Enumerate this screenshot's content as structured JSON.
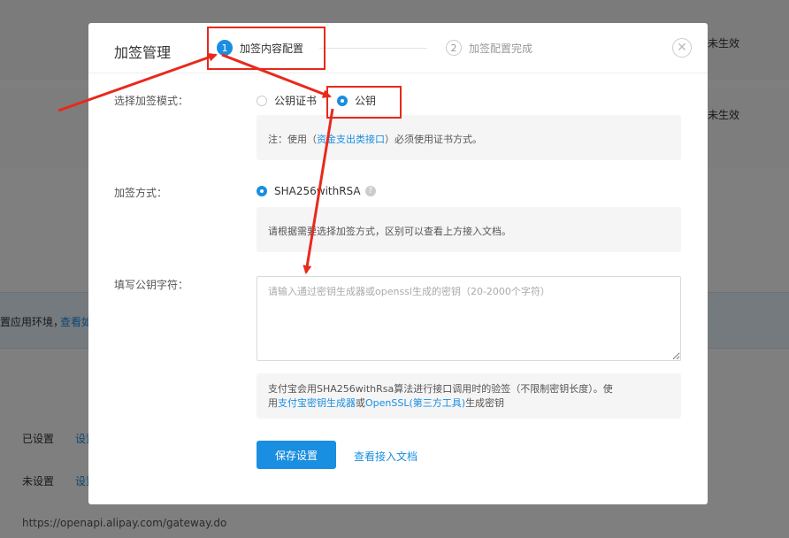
{
  "background": {
    "right_status": [
      "未生效",
      "未生效"
    ],
    "info_text": "置应用环境，",
    "info_link": "查看如",
    "rows": [
      {
        "status": "已设置",
        "link": "设置"
      },
      {
        "status": "未设置",
        "link": "设置"
      }
    ],
    "gateway_url": "https://openapi.alipay.com/gateway.do"
  },
  "modal": {
    "title": "加签管理",
    "steps": [
      {
        "num": "1",
        "label": "加签内容配置"
      },
      {
        "num": "2",
        "label": "加签配置完成"
      }
    ],
    "mode_label": "选择加签模式：",
    "mode_options": [
      "公钥证书",
      "公钥"
    ],
    "mode_selected": "公钥",
    "mode_note_prefix": "注：使用（",
    "mode_note_link": "资金支出类接口",
    "mode_note_suffix": "）必须使用证书方式。",
    "method_label": "加签方式：",
    "method_option": "SHA256withRSA",
    "method_help": "?",
    "method_note": "请根据需要选择加签方式，区别可以查看上方接入文档。",
    "key_label": "填写公钥字符：",
    "key_value": "",
    "key_placeholder": "请输入通过密钥生成器或openssl生成的密钥（20-2000个字符）",
    "key_note_1": "支付宝会用SHA256withRsa算法进行接口调用时的验签（不限制密钥长度）。使",
    "key_note_2_prefix": "用",
    "key_note_link1": "支付宝密钥生成器",
    "key_note_or": "或",
    "key_note_link2": "OpenSSL(第三方工具)",
    "key_note_suffix": "生成密钥",
    "save_label": "保存设置",
    "doc_link_label": "查看接入文档",
    "close_glyph": "✕"
  },
  "colors": {
    "accent": "#1a8ee0",
    "annotation": "#e8291c"
  }
}
